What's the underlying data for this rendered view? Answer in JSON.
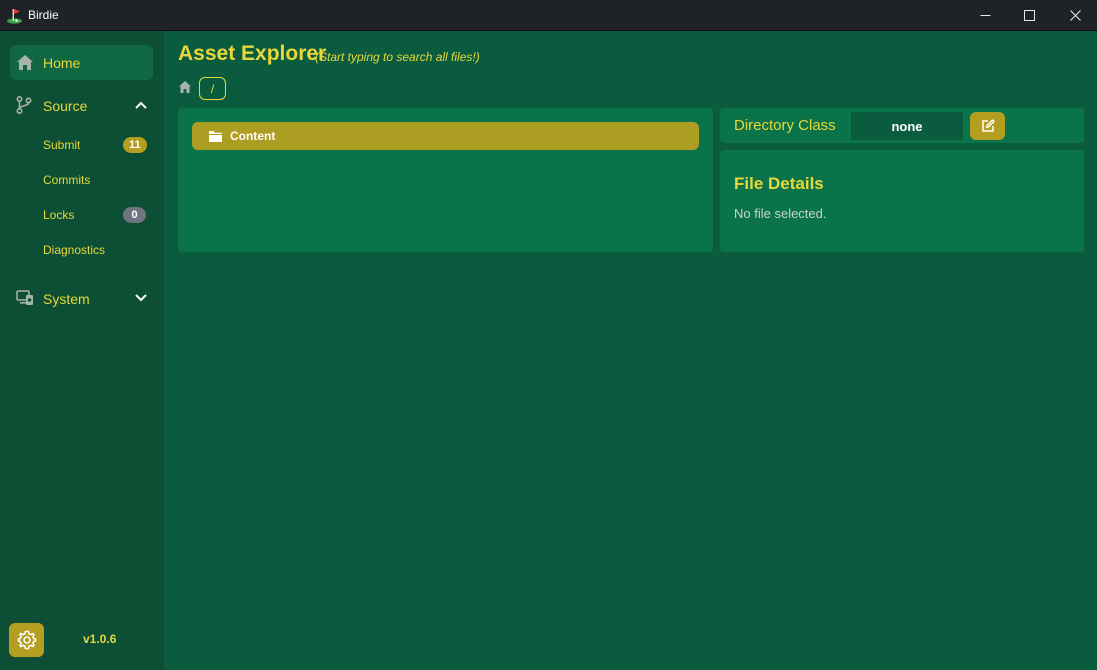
{
  "window": {
    "title": "Birdie",
    "icon": "golf-flag-icon",
    "controls": [
      "minimize-icon",
      "maximize-icon",
      "close-icon"
    ]
  },
  "sidebar": {
    "home_label": "Home",
    "source": {
      "label": "Source",
      "expanded": true,
      "items": [
        {
          "label": "Submit",
          "badge": "11"
        },
        {
          "label": "Commits",
          "badge": null
        },
        {
          "label": "Locks",
          "badge": "0"
        },
        {
          "label": "Diagnostics",
          "badge": null
        }
      ]
    },
    "system": {
      "label": "System",
      "expanded": false
    },
    "version": "v1.0.6"
  },
  "main": {
    "title": "Asset Explorer",
    "hint": "(Start typing to search all files!)",
    "breadcrumb": {
      "path": "/"
    },
    "files": [
      {
        "name": "Content",
        "type": "folder"
      }
    ],
    "directory_class": {
      "label": "Directory Class",
      "value": "none"
    },
    "file_details": {
      "title": "File Details",
      "empty_text": "No file selected."
    }
  },
  "colors": {
    "accent_text": "#e8d73a",
    "accent_button": "#b49e20",
    "panel_bg": "#0b7349",
    "page_bg": "#0b5c3f",
    "sidebar_bg": "#0d4f35",
    "titlebar_bg": "#1f2227"
  }
}
